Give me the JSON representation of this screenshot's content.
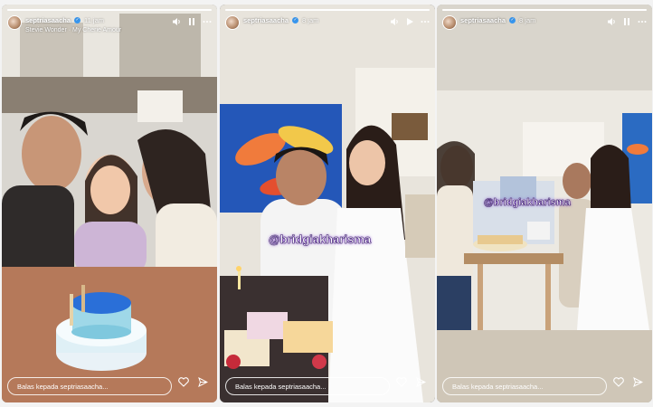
{
  "stories": [
    {
      "username": "septriasaacha",
      "time": "11 jam",
      "music": "Stevie Wonder · My Cherie Amour",
      "reply_placeholder": "Balas kepada septriasaacha..."
    },
    {
      "username": "septriasaacha",
      "time": "8 jam",
      "tag": "@bridgiakharisma",
      "reply_placeholder": "Balas kepada septriasaacha..."
    },
    {
      "username": "septriasaacha",
      "time": "8 jam",
      "tag": "@bridgiakharisma",
      "reply_placeholder": "Balas kepada septriasaacha..."
    }
  ],
  "icons": {
    "mute": "speaker-icon",
    "pause": "pause-icon",
    "play": "play-icon",
    "more": "more-icon",
    "like": "heart-icon",
    "share": "send-icon",
    "verified": "verified-badge-icon"
  },
  "colors": {
    "verified": "#3897f0",
    "tag_glow": "#7a2fd0"
  }
}
